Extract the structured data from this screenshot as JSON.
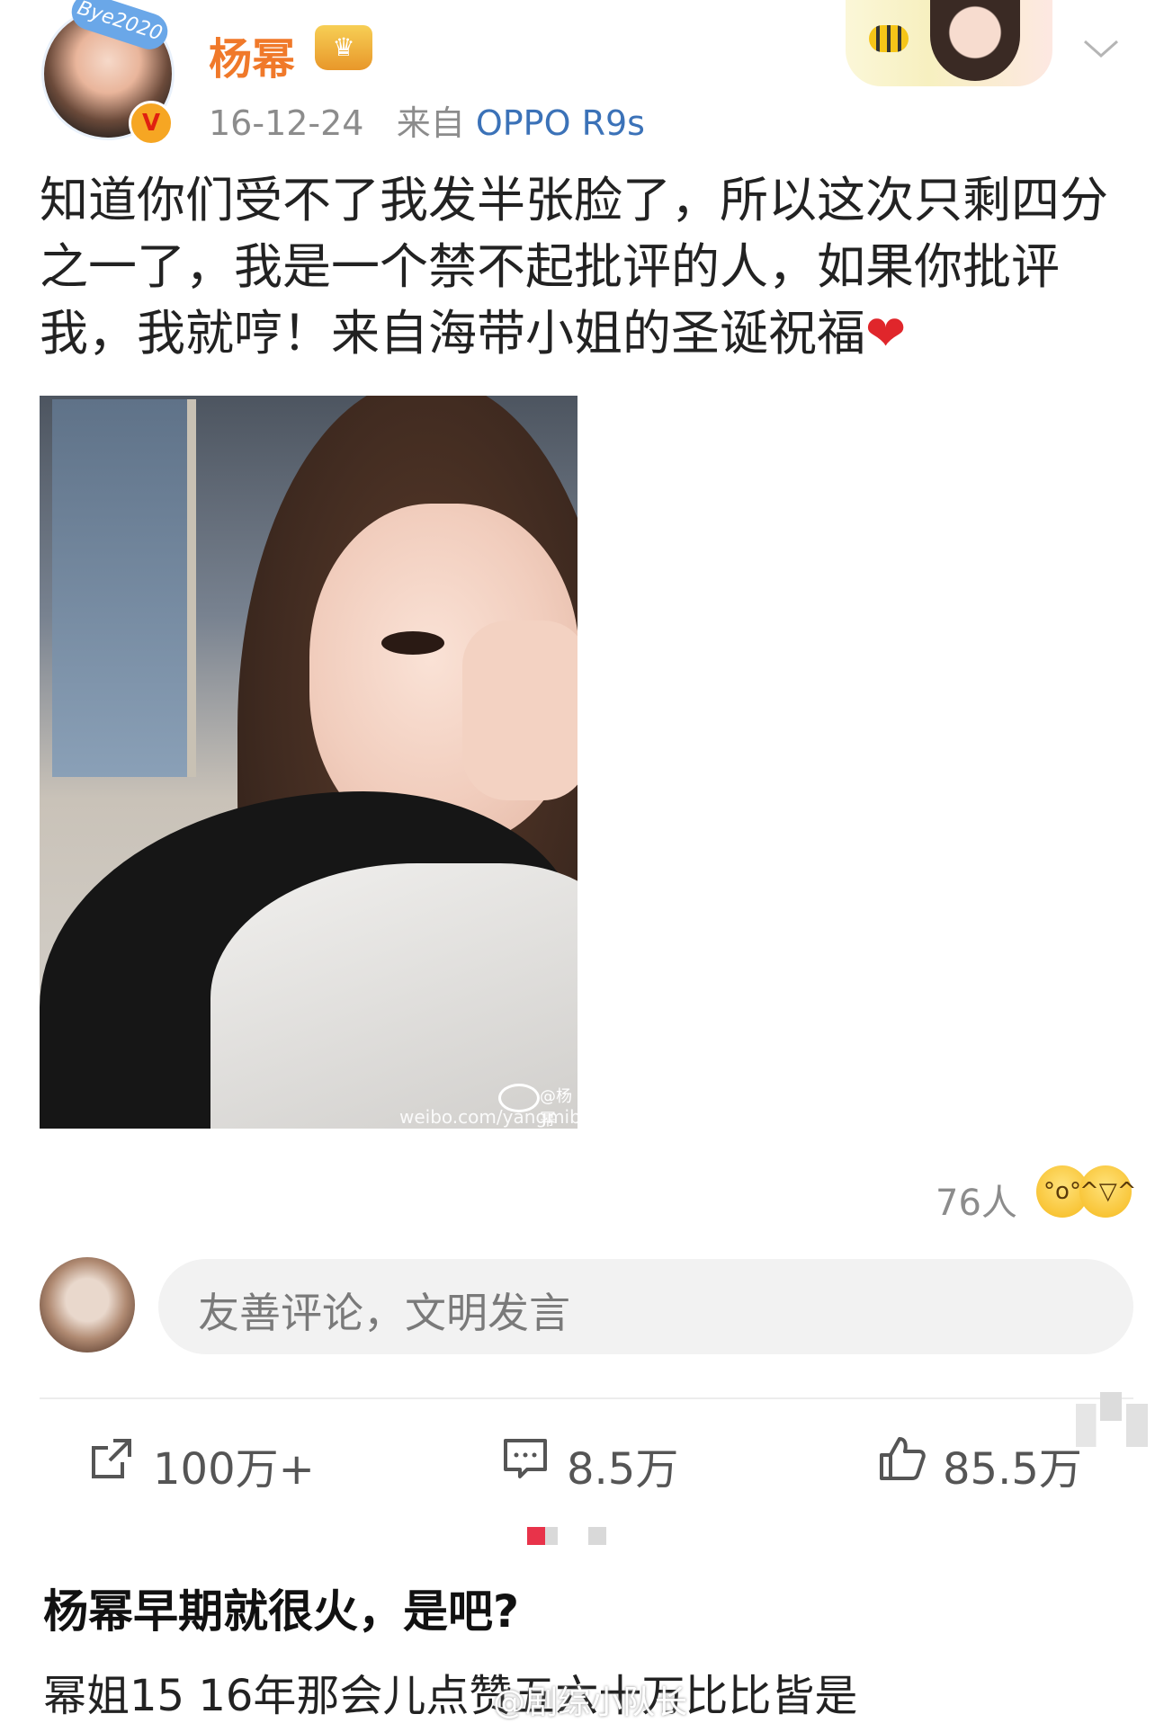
{
  "post": {
    "author": "杨幂",
    "avatar_badge": "Bye2020",
    "verified_mark": "V",
    "date": "16-12-24",
    "source_prefix": "来自",
    "device": "OPPO R9s",
    "text": "知道你们受不了我发半张脸了，所以这次只剩四分之一了，我是一个禁不起批评的人，如果你批评我，我就哼！来自海带小姐的圣诞祝福",
    "heart": "❤",
    "image_watermark": "weibo.com/yangmiblog",
    "image_watermark_user": "@杨幂"
  },
  "reactions": {
    "count_label": "76人",
    "icons": [
      "wow-icon",
      "laugh-icon"
    ]
  },
  "comment_box": {
    "placeholder": "友善评论，文明发言"
  },
  "actions": {
    "share": "100万+",
    "comment": "8.5万",
    "like": "85.5万"
  },
  "pager": {
    "active_color": "#e8334a"
  },
  "caption": {
    "title": "杨幂早期就很火，是吧?",
    "body": "幂姐15 16年那会儿点赞五六十万比比皆是",
    "watermark": "@剧综小队长"
  },
  "colors": {
    "username": "#f0792a",
    "device_link": "#3b72b8",
    "heart": "#e0262b"
  }
}
